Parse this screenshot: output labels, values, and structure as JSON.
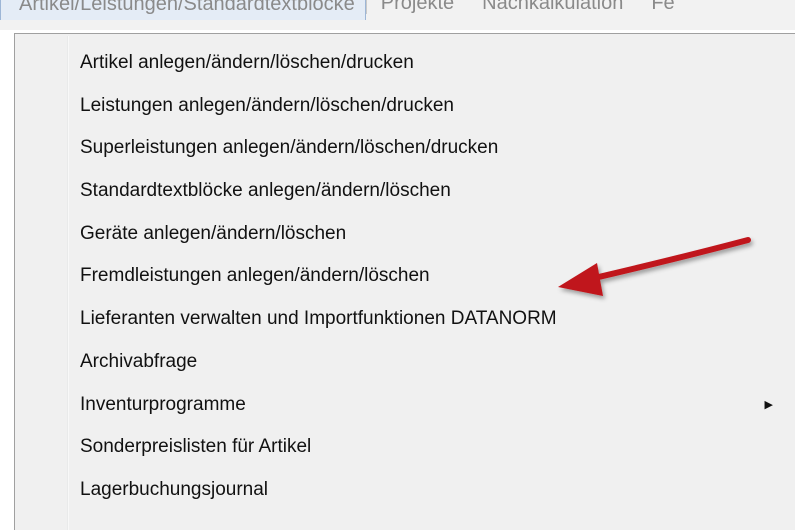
{
  "menubar": {
    "items": [
      {
        "label": "Artikel/Leistungen/Standardtextblöcke"
      },
      {
        "label": "Projekte"
      },
      {
        "label": "Nachkalkulation"
      },
      {
        "label": "Fe"
      }
    ]
  },
  "dropdown": {
    "items": [
      {
        "label": "Artikel anlegen/ändern/löschen/drucken"
      },
      {
        "label": "Leistungen anlegen/ändern/löschen/drucken"
      },
      {
        "label": "Superleistungen anlegen/ändern/löschen/drucken"
      },
      {
        "label": "Standardtextblöcke anlegen/ändern/löschen"
      },
      {
        "label": "Geräte anlegen/ändern/löschen"
      },
      {
        "label": "Fremdleistungen anlegen/ändern/löschen"
      },
      {
        "label": "Lieferanten verwalten und Importfunktionen DATANORM"
      },
      {
        "label": "Archivabfrage"
      },
      {
        "label": "Inventurprogramme",
        "submenu_icon": "chevron-right-icon"
      },
      {
        "label": "Sonderpreislisten für Artikel"
      },
      {
        "label": "Lagerbuchungsjournal"
      }
    ]
  },
  "annotation": {
    "icon": "arrow-annotation-icon",
    "color": "#c0141a"
  }
}
